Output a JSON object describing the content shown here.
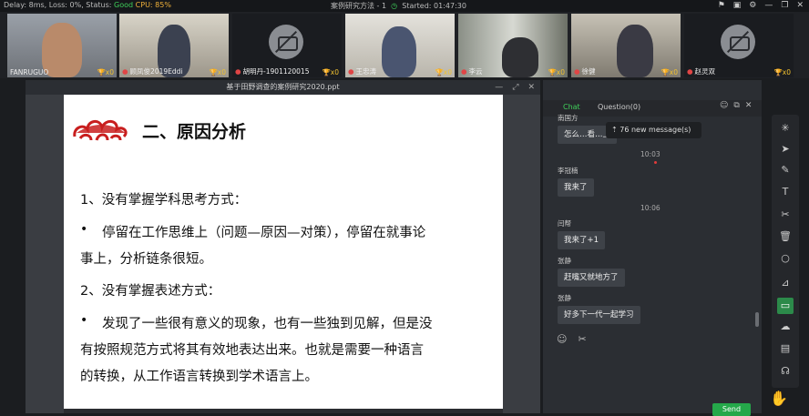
{
  "topbar": {
    "delay_label": "Delay: 8ms, Loss: 0%, Status:",
    "status": "Good",
    "cpu": "CPU: 85%",
    "room_title": "案例研究方法 - 1",
    "started": "Started: 01:47:30"
  },
  "participants": [
    {
      "name": "FANRUGUO",
      "cam": "on",
      "trophy": "x0"
    },
    {
      "name": "顾凤俊2019Eddi",
      "cam": "on",
      "trophy": "x0"
    },
    {
      "name": "胡明丹-1901120015",
      "cam": "off",
      "trophy": "x0"
    },
    {
      "name": "王忠涛",
      "cam": "on",
      "trophy": "x0"
    },
    {
      "name": "李云",
      "cam": "on",
      "trophy": "x0"
    },
    {
      "name": "徐健",
      "cam": "on",
      "trophy": "x0"
    },
    {
      "name": "赵灵双",
      "cam": "off",
      "trophy": "x0"
    }
  ],
  "ppt": {
    "window_title": "基于田野调查的案例研究2020.ppt",
    "slide_title": "二、原因分析",
    "lines": [
      "1、没有掌握学科思考方式：",
      "停留在工作思维上（问题—原因—对策），停留在就事论",
      "事上，分析链条很短。",
      "2、没有掌握表述方式：",
      "发现了一些很有意义的现象，也有一些独到见解，但是没",
      "有按照规范方式将其有效地表达出来。也就是需要一种语言",
      "的转换，从工作语言转换到学术语言上。"
    ],
    "bullet": "•"
  },
  "chat": {
    "tab_chat": "Chat",
    "tab_question": "Question(0)",
    "new_message": "76 new message(s)",
    "messages": [
      {
        "name": "南国方",
        "text": "怎么…看…上"
      },
      {
        "time": "10:03"
      },
      {
        "name": "李冠楠",
        "text": "我来了"
      },
      {
        "time": "10:06"
      },
      {
        "name": "闫帮",
        "text": "我来了+1"
      },
      {
        "name": "张静",
        "text": "赶嘴又就地方了"
      },
      {
        "name": "张静",
        "text": "好多下一代一起学习"
      }
    ],
    "send_label": "Send"
  },
  "colors": {
    "good": "#3fcf5a",
    "cpu": "#f0b13a",
    "send": "#25a84a",
    "logo_red": "#c81e1e"
  }
}
